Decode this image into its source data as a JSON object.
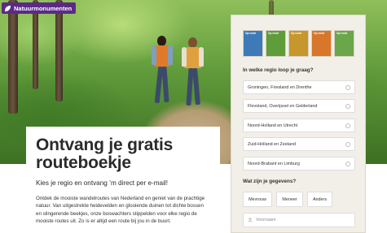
{
  "brand": {
    "logo_text": "Natuurmonumenten",
    "logo_icon": "leaf-icon",
    "color": "#5b2a86"
  },
  "hero": {
    "photo": "two-women-walking-forest-path"
  },
  "intro": {
    "headline": "Ontvang je gratis routeboekje",
    "subhead": "Kies je regio en ontvang ’m direct per e-mail!",
    "body": "Ontdek de mooiste wandelroutes van Nederland en geniet van de prachtige natuur. Van uitgestrekte heidevelden en glooiende duinen tot dichte bossen en slingerende beekjes, onze boswachters stippelden voor elke regio de mooiste routes uit. Zo is er altijd een route bij jou in de buurt."
  },
  "form": {
    "booklets": [
      {
        "title": "Op route",
        "color": "#3f7ab8"
      },
      {
        "title": "Op route",
        "color": "#5f9c3a"
      },
      {
        "title": "Op route",
        "color": "#c7962c"
      },
      {
        "title": "Op route",
        "color": "#d8762a"
      },
      {
        "title": "Op route",
        "color": "#6aa64a"
      }
    ],
    "region_question": "In welke regio loop je graag?",
    "regions": [
      "Groningen, Friesland en Drenthe",
      "Flevoland, Overijssel en Gelderland",
      "Noord-Holland en Utrecht",
      "Zuid-Holland en Zeeland",
      "Noord-Brabant en Limburg"
    ],
    "details_question": "Wat zijn je gegevens?",
    "salutations": [
      "Mevrouw",
      "Meneer",
      "Anders"
    ],
    "first_name_placeholder": "Voornaam"
  }
}
